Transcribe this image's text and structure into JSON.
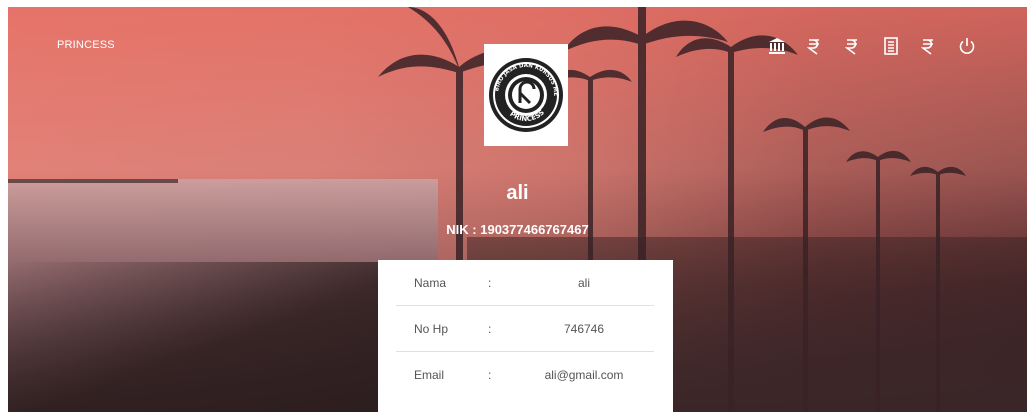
{
  "header": {
    "brand": "PRINCESS",
    "icons": [
      "bank-icon",
      "payment-icon",
      "payment-icon-2",
      "document-icon",
      "payment-icon-3",
      "power-icon"
    ]
  },
  "logo": {
    "ring_text_top": "BIRO JASA DAN KURSUS MENGEMUDI",
    "ring_text_bottom": "PRINCESS"
  },
  "profile": {
    "name": "ali",
    "nik": "NIK : 190377466767467"
  },
  "details": {
    "rows": [
      {
        "label": "Nama",
        "sep": ":",
        "value": "ali"
      },
      {
        "label": "No Hp",
        "sep": ":",
        "value": "746746"
      },
      {
        "label": "Email",
        "sep": ":",
        "value": "ali@gmail.com"
      }
    ]
  }
}
